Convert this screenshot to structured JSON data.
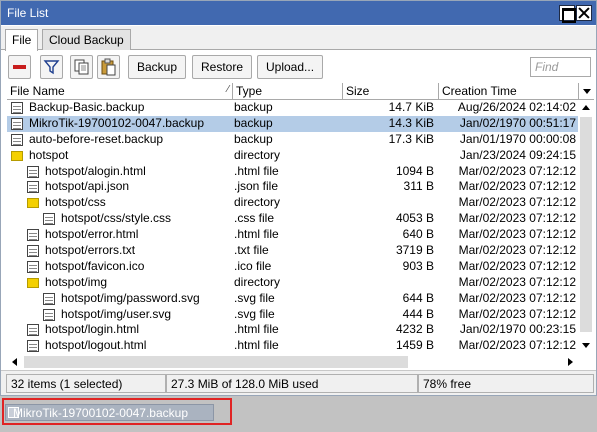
{
  "window": {
    "title": "File List"
  },
  "tabs": [
    {
      "label": "File"
    },
    {
      "label": "Cloud Backup"
    }
  ],
  "toolbar": {
    "icons": [
      "minus-icon",
      "filter-icon",
      "copy-icon",
      "paste-icon"
    ],
    "backup_label": "Backup",
    "restore_label": "Restore",
    "upload_label": "Upload...",
    "find_placeholder": "Find",
    "find_value": ""
  },
  "columns": {
    "name": "File Name",
    "type": "Type",
    "size": "Size",
    "time": "Creation Time"
  },
  "rows": [
    {
      "name": "Backup-Basic.backup",
      "type": "backup",
      "size": "14.7 KiB",
      "time": "Aug/26/2024 02:14:02",
      "indent": 0,
      "kind": "file",
      "selected": false
    },
    {
      "name": "MikroTik-19700102-0047.backup",
      "type": "backup",
      "size": "14.3 KiB",
      "time": "Jan/02/1970 00:51:17",
      "indent": 0,
      "kind": "file",
      "selected": true
    },
    {
      "name": "auto-before-reset.backup",
      "type": "backup",
      "size": "17.3 KiB",
      "time": "Jan/01/1970 00:00:08",
      "indent": 0,
      "kind": "file",
      "selected": false
    },
    {
      "name": "hotspot",
      "type": "directory",
      "size": "",
      "time": "Jan/23/2024 09:24:15",
      "indent": 0,
      "kind": "folder",
      "selected": false
    },
    {
      "name": "hotspot/alogin.html",
      "type": ".html file",
      "size": "1094 B",
      "time": "Mar/02/2023 07:12:12",
      "indent": 1,
      "kind": "file",
      "selected": false
    },
    {
      "name": "hotspot/api.json",
      "type": ".json file",
      "size": "311 B",
      "time": "Mar/02/2023 07:12:12",
      "indent": 1,
      "kind": "file",
      "selected": false
    },
    {
      "name": "hotspot/css",
      "type": "directory",
      "size": "",
      "time": "Mar/02/2023 07:12:12",
      "indent": 1,
      "kind": "folder",
      "selected": false
    },
    {
      "name": "hotspot/css/style.css",
      "type": ".css file",
      "size": "4053 B",
      "time": "Mar/02/2023 07:12:12",
      "indent": 2,
      "kind": "file",
      "selected": false
    },
    {
      "name": "hotspot/error.html",
      "type": ".html file",
      "size": "640 B",
      "time": "Mar/02/2023 07:12:12",
      "indent": 1,
      "kind": "file",
      "selected": false
    },
    {
      "name": "hotspot/errors.txt",
      "type": ".txt file",
      "size": "3719 B",
      "time": "Mar/02/2023 07:12:12",
      "indent": 1,
      "kind": "file",
      "selected": false
    },
    {
      "name": "hotspot/favicon.ico",
      "type": ".ico file",
      "size": "903 B",
      "time": "Mar/02/2023 07:12:12",
      "indent": 1,
      "kind": "file",
      "selected": false
    },
    {
      "name": "hotspot/img",
      "type": "directory",
      "size": "",
      "time": "Mar/02/2023 07:12:12",
      "indent": 1,
      "kind": "folder",
      "selected": false
    },
    {
      "name": "hotspot/img/password.svg",
      "type": ".svg file",
      "size": "644 B",
      "time": "Mar/02/2023 07:12:12",
      "indent": 2,
      "kind": "file",
      "selected": false
    },
    {
      "name": "hotspot/img/user.svg",
      "type": ".svg file",
      "size": "444 B",
      "time": "Mar/02/2023 07:12:12",
      "indent": 2,
      "kind": "file",
      "selected": false
    },
    {
      "name": "hotspot/login.html",
      "type": ".html file",
      "size": "4232 B",
      "time": "Jan/02/1970 00:23:15",
      "indent": 1,
      "kind": "file",
      "selected": false
    },
    {
      "name": "hotspot/logout.html",
      "type": ".html file",
      "size": "1459 B",
      "time": "Mar/02/2023 07:12:12",
      "indent": 1,
      "kind": "file",
      "selected": false
    }
  ],
  "status": {
    "count": "32 items (1 selected)",
    "usage": "27.3 MiB of 128.0 MiB used",
    "free": "78% free"
  },
  "minimized": {
    "label": "MikroTik-19700102-0047.backup"
  },
  "colors": {
    "title_bar": "#4169b0",
    "selection": "#b4cce7",
    "folder": "#f4d000",
    "highlight_frame": "#e02424"
  }
}
